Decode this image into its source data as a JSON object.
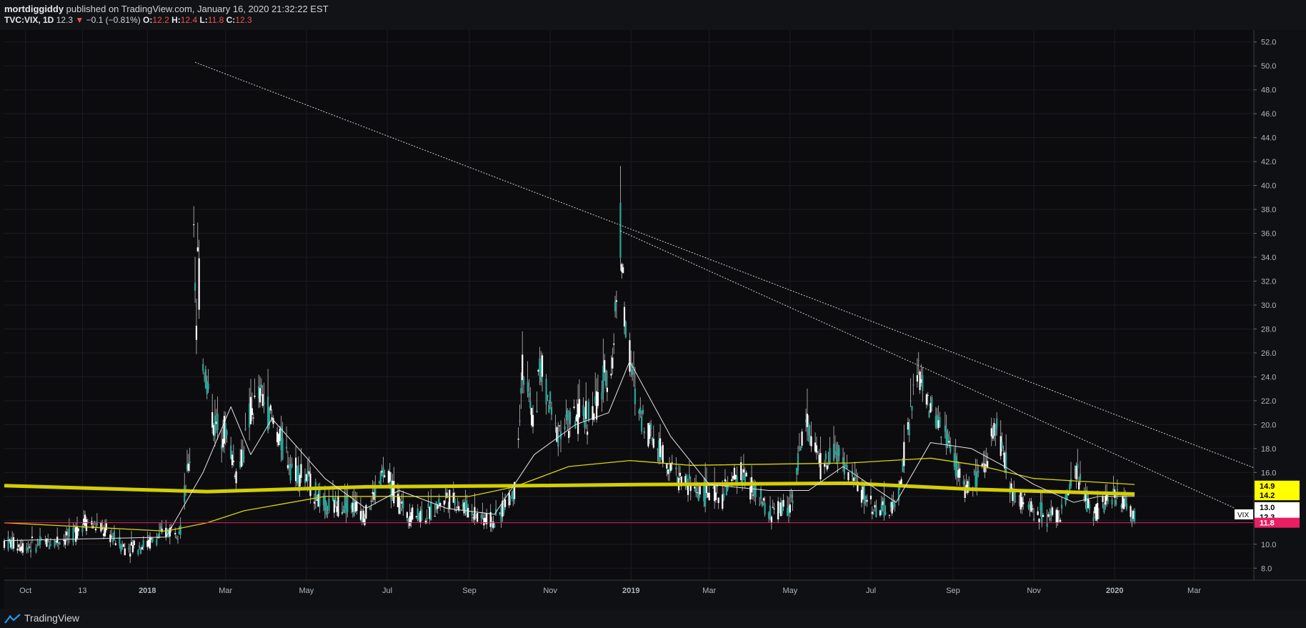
{
  "header": {
    "author": "mortdiggiddy",
    "published_text": "published on TradingView.com, January 16, 2020 21:32:22 EST",
    "symbol": "TVC:VIX, 1D",
    "last": "12.3",
    "change_arrow": "▼",
    "change": "−0.1 (−0.81%)",
    "o_label": "O:",
    "o_value": "12.2",
    "h_label": "H:",
    "h_value": "12.4",
    "l_label": "L:",
    "l_value": "11.8",
    "c_label": "C:",
    "c_value": "12.3"
  },
  "footer": {
    "brand": "TradingView",
    "logo_icon": "tradingview-logo-icon"
  },
  "colors": {
    "background": "#0c0c0f",
    "candle": "#ffffff",
    "ma_fast": "#e6e6e6",
    "ma_mid": "#d9d600",
    "ma_slow": "#d4cf00",
    "support_line": "#e91e63",
    "trendline": "#cfcfcf"
  },
  "chart_data": {
    "type": "candlestick",
    "symbol": "TVC:VIX",
    "interval": "1D",
    "ylim": [
      7,
      53
    ],
    "y_ticks": [
      8,
      10,
      12,
      14,
      16,
      18,
      20,
      22,
      24,
      26,
      28,
      30,
      32,
      34,
      36,
      38,
      40,
      42,
      44,
      46,
      48,
      50,
      52
    ],
    "x_labels": [
      {
        "label": "Oct",
        "date": "2017-10-01"
      },
      {
        "label": "13",
        "date": "2017-11-13"
      },
      {
        "label": "2018",
        "date": "2018-01-01"
      },
      {
        "label": "Mar",
        "date": "2018-03-01"
      },
      {
        "label": "May",
        "date": "2018-05-01"
      },
      {
        "label": "Jul",
        "date": "2018-07-01"
      },
      {
        "label": "Sep",
        "date": "2018-09-01"
      },
      {
        "label": "Nov",
        "date": "2018-11-01"
      },
      {
        "label": "2019",
        "date": "2019-01-01"
      },
      {
        "label": "Mar",
        "date": "2019-03-01"
      },
      {
        "label": "May",
        "date": "2019-05-01"
      },
      {
        "label": "Jul",
        "date": "2019-07-01"
      },
      {
        "label": "Sep",
        "date": "2019-09-01"
      },
      {
        "label": "Nov",
        "date": "2019-11-01"
      },
      {
        "label": "2020",
        "date": "2020-01-01"
      },
      {
        "label": "Mar",
        "date": "2020-03-01"
      }
    ],
    "x_range": [
      "2017-09-15",
      "2020-04-15"
    ],
    "close_path": [
      [
        "2017-09-15",
        10.2
      ],
      [
        "2017-10-01",
        9.8
      ],
      [
        "2017-10-20",
        10.2
      ],
      [
        "2017-11-05",
        10.6
      ],
      [
        "2017-11-15",
        12.0
      ],
      [
        "2017-12-01",
        11.0
      ],
      [
        "2017-12-15",
        9.7
      ],
      [
        "2018-01-01",
        10.0
      ],
      [
        "2018-01-15",
        11.0
      ],
      [
        "2018-01-26",
        11.5
      ],
      [
        "2018-02-02",
        17.3
      ],
      [
        "2018-02-05",
        37.3
      ],
      [
        "2018-02-07",
        28.0
      ],
      [
        "2018-02-08",
        33.5
      ],
      [
        "2018-02-12",
        25.5
      ],
      [
        "2018-02-20",
        20.0
      ],
      [
        "2018-03-01",
        19.5
      ],
      [
        "2018-03-10",
        15.5
      ],
      [
        "2018-03-20",
        21.0
      ],
      [
        "2018-03-28",
        22.5
      ],
      [
        "2018-04-10",
        19.0
      ],
      [
        "2018-04-20",
        16.5
      ],
      [
        "2018-05-01",
        15.5
      ],
      [
        "2018-05-15",
        13.0
      ],
      [
        "2018-06-01",
        13.5
      ],
      [
        "2018-06-15",
        12.5
      ],
      [
        "2018-06-28",
        16.0
      ],
      [
        "2018-07-15",
        12.5
      ],
      [
        "2018-08-01",
        12.5
      ],
      [
        "2018-08-15",
        14.0
      ],
      [
        "2018-09-01",
        12.8
      ],
      [
        "2018-09-20",
        11.8
      ],
      [
        "2018-10-05",
        14.5
      ],
      [
        "2018-10-11",
        24.8
      ],
      [
        "2018-10-20",
        19.5
      ],
      [
        "2018-10-24",
        25.0
      ],
      [
        "2018-11-05",
        19.5
      ],
      [
        "2018-11-20",
        20.5
      ],
      [
        "2018-12-04",
        21.0
      ],
      [
        "2018-12-18",
        25.5
      ],
      [
        "2018-12-24",
        36.1
      ],
      [
        "2018-12-28",
        28.0
      ],
      [
        "2019-01-05",
        21.5
      ],
      [
        "2019-01-20",
        18.5
      ],
      [
        "2019-02-05",
        15.5
      ],
      [
        "2019-02-20",
        14.5
      ],
      [
        "2019-03-10",
        14.0
      ],
      [
        "2019-03-25",
        16.0
      ],
      [
        "2019-04-15",
        12.5
      ],
      [
        "2019-05-01",
        13.2
      ],
      [
        "2019-05-13",
        20.5
      ],
      [
        "2019-05-25",
        16.0
      ],
      [
        "2019-06-03",
        18.0
      ],
      [
        "2019-06-20",
        15.0
      ],
      [
        "2019-07-05",
        12.8
      ],
      [
        "2019-07-20",
        13.0
      ],
      [
        "2019-08-05",
        24.5
      ],
      [
        "2019-08-15",
        21.0
      ],
      [
        "2019-08-25",
        19.5
      ],
      [
        "2019-09-10",
        14.5
      ],
      [
        "2019-09-25",
        16.0
      ],
      [
        "2019-10-03",
        20.5
      ],
      [
        "2019-10-15",
        14.5
      ],
      [
        "2019-11-01",
        12.8
      ],
      [
        "2019-11-20",
        12.3
      ],
      [
        "2019-12-03",
        15.8
      ],
      [
        "2019-12-15",
        12.6
      ],
      [
        "2020-01-03",
        14.0
      ],
      [
        "2020-01-08",
        13.5
      ],
      [
        "2020-01-16",
        12.3
      ]
    ],
    "ma_fast_path": [
      [
        "2017-09-15",
        10.3
      ],
      [
        "2018-01-15",
        10.6
      ],
      [
        "2018-02-12",
        16.0
      ],
      [
        "2018-03-05",
        21.5
      ],
      [
        "2018-03-20",
        17.5
      ],
      [
        "2018-04-05",
        20.5
      ],
      [
        "2018-05-15",
        15.5
      ],
      [
        "2018-06-15",
        13.0
      ],
      [
        "2018-07-10",
        14.5
      ],
      [
        "2018-08-15",
        13.0
      ],
      [
        "2018-09-20",
        12.5
      ],
      [
        "2018-10-20",
        17.5
      ],
      [
        "2018-11-20",
        20.0
      ],
      [
        "2018-12-15",
        21.0
      ],
      [
        "2018-12-31",
        25.3
      ],
      [
        "2019-01-31",
        19.0
      ],
      [
        "2019-03-01",
        15.0
      ],
      [
        "2019-04-15",
        14.5
      ],
      [
        "2019-05-15",
        14.5
      ],
      [
        "2019-06-10",
        16.5
      ],
      [
        "2019-07-20",
        13.5
      ],
      [
        "2019-08-15",
        18.5
      ],
      [
        "2019-09-15",
        18.0
      ],
      [
        "2019-10-10",
        16.5
      ],
      [
        "2019-11-01",
        15.0
      ],
      [
        "2019-12-01",
        13.5
      ],
      [
        "2019-12-20",
        14.0
      ],
      [
        "2020-01-16",
        14.0
      ]
    ],
    "ma_mid_path": [
      [
        "2017-09-15",
        11.8
      ],
      [
        "2018-01-15",
        11.1
      ],
      [
        "2018-02-15",
        11.8
      ],
      [
        "2018-03-15",
        12.8
      ],
      [
        "2018-05-15",
        14.0
      ],
      [
        "2018-09-01",
        14.0
      ],
      [
        "2018-10-05",
        14.8
      ],
      [
        "2018-11-15",
        16.5
      ],
      [
        "2018-12-31",
        17.0
      ],
      [
        "2019-02-15",
        16.6
      ],
      [
        "2019-06-15",
        16.8
      ],
      [
        "2019-08-15",
        17.2
      ],
      [
        "2019-09-20",
        16.6
      ],
      [
        "2019-11-01",
        15.5
      ],
      [
        "2020-01-16",
        15.0
      ]
    ],
    "ma_slow_path": [
      [
        "2017-09-15",
        14.9
      ],
      [
        "2018-02-15",
        14.4
      ],
      [
        "2018-06-15",
        14.8
      ],
      [
        "2018-10-15",
        14.9
      ],
      [
        "2019-01-15",
        15.0
      ],
      [
        "2019-06-15",
        15.1
      ],
      [
        "2019-09-15",
        14.6
      ],
      [
        "2019-11-15",
        14.4
      ],
      [
        "2020-01-16",
        14.2
      ]
    ],
    "trendlines": [
      {
        "from": [
          "2018-02-06",
          50.3
        ],
        "to": [
          "2020-04-15",
          16.4
        ]
      },
      {
        "from": [
          "2018-12-24",
          36.2
        ],
        "to": [
          "2020-04-01",
          13.0
        ]
      }
    ],
    "support_level": 11.8,
    "price_labels": [
      {
        "text": "14.9",
        "value": 14.9,
        "bg": "#ffff00",
        "fg": "#000000"
      },
      {
        "text": "14.2",
        "value": 14.1,
        "bg": "#ffff00",
        "fg": "#000000"
      },
      {
        "text": "13.0",
        "value": 13.1,
        "bg": "#ffffff",
        "fg": "#000000"
      },
      {
        "text": "12.3",
        "value": 12.3,
        "bg": "#ffffff",
        "fg": "#000000"
      },
      {
        "text": "11.8",
        "value": 11.8,
        "bg": "#e91e63",
        "fg": "#ffffff"
      }
    ],
    "series_tag": {
      "text": "VIX",
      "value": 12.5
    }
  }
}
